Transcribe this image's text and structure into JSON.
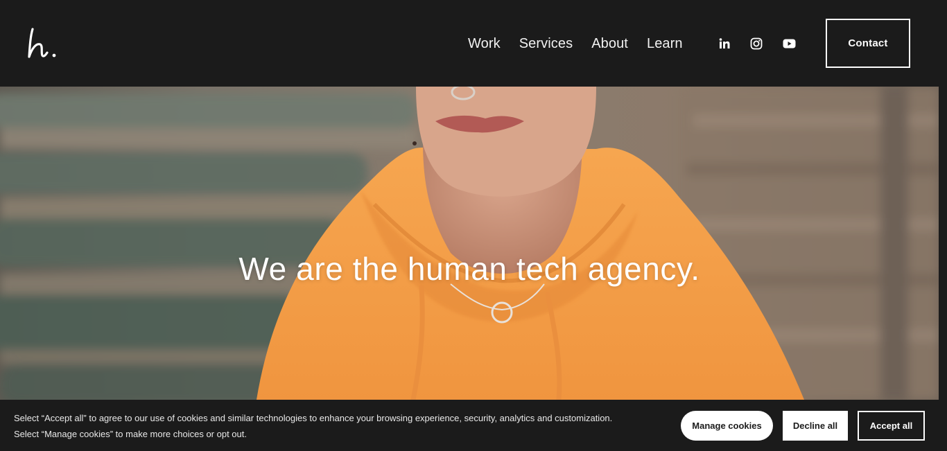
{
  "header": {
    "logo_icon": "h-signature-logo",
    "nav": [
      {
        "label": "Work"
      },
      {
        "label": "Services"
      },
      {
        "label": "About"
      },
      {
        "label": "Learn"
      }
    ],
    "social": [
      "linkedin-icon",
      "instagram-icon",
      "youtube-icon"
    ],
    "contact_label": "Contact"
  },
  "hero": {
    "title": "We are the human tech agency."
  },
  "cookie": {
    "text": "Select “Accept all” to agree to our use of cookies and similar technologies to enhance your browsing experience, security, analytics and customization. Select “Manage cookies” to make more choices or opt out.",
    "manage_label": "Manage cookies",
    "decline_label": "Decline all",
    "accept_label": "Accept all"
  },
  "colors": {
    "background": "#1b1b1b",
    "hoodie": "#f4a04e",
    "text": "#ffffff"
  }
}
